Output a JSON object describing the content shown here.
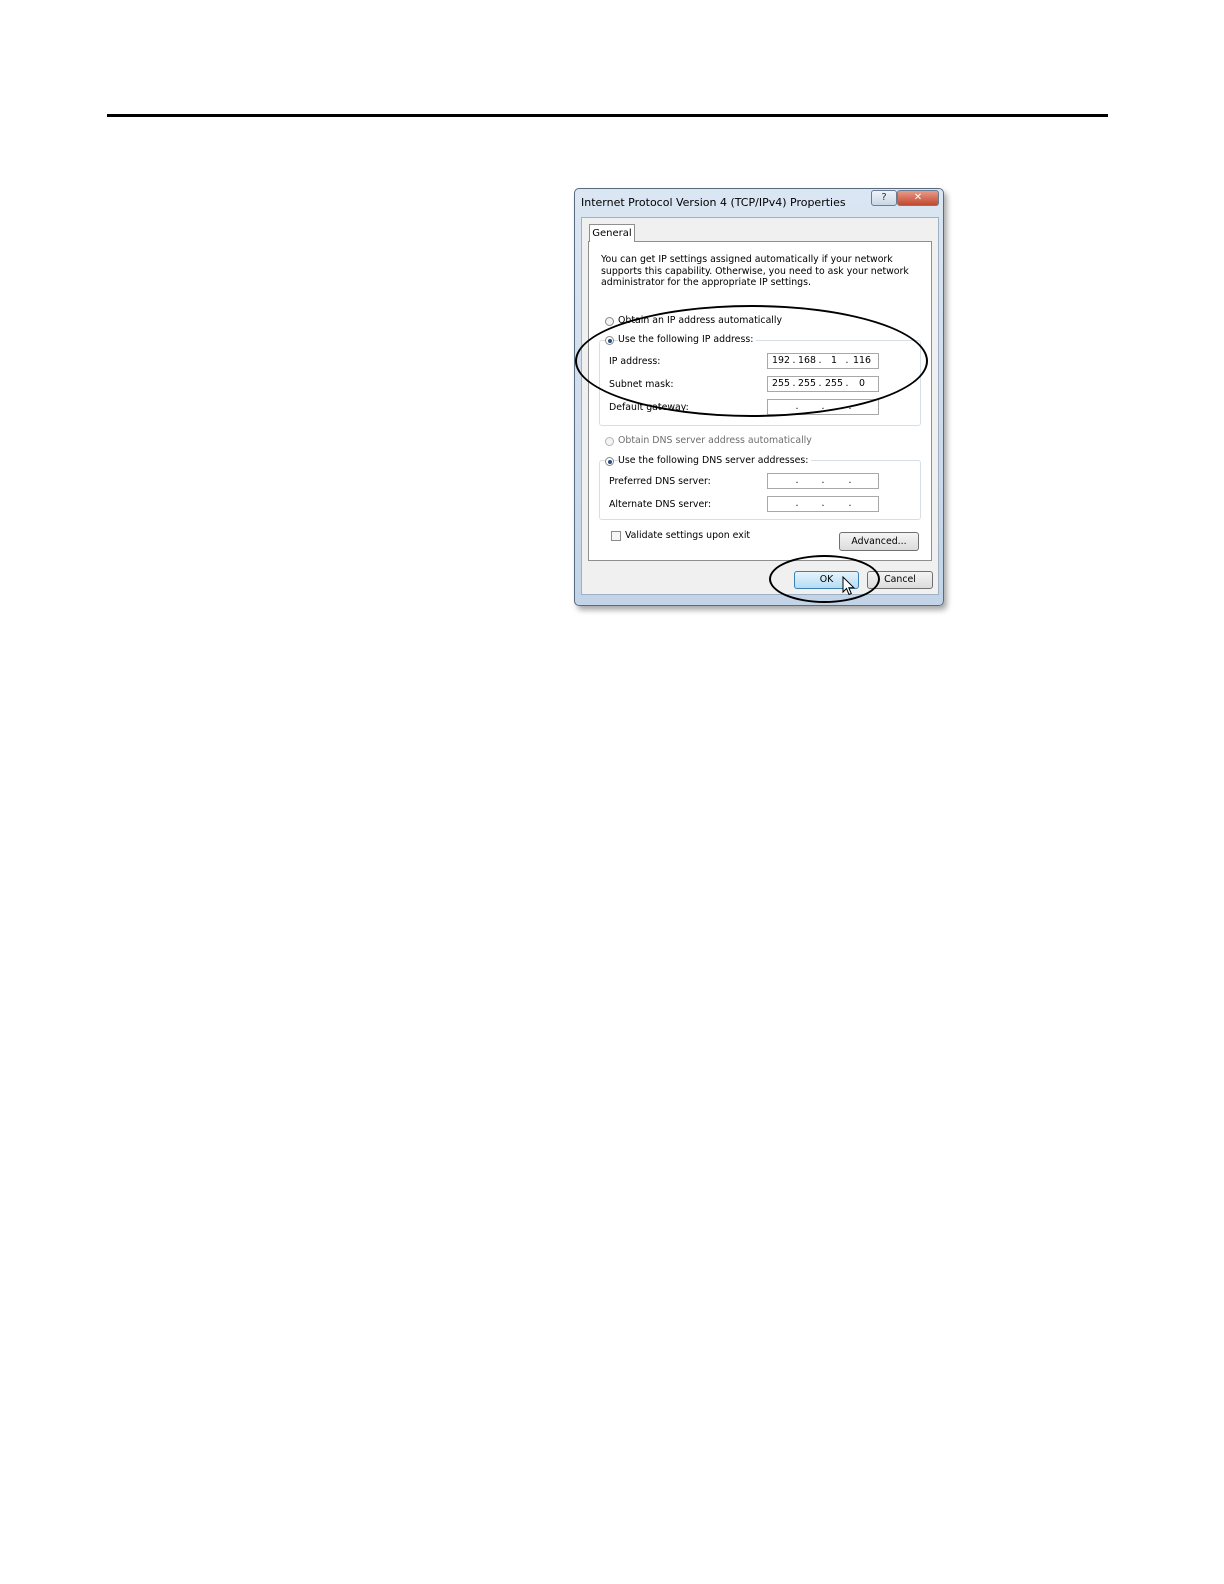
{
  "dialog": {
    "title": "Internet Protocol Version 4 (TCP/IPv4) Properties",
    "help_glyph": "?",
    "close_glyph": "✕",
    "tab_label": "General",
    "intro_text": "You can get IP settings assigned automatically if your network supports this capability. Otherwise, you need to ask your network administrator for the appropriate IP settings.",
    "ip_auto_label": "Obtain an IP address automatically",
    "ip_manual_label": "Use the following IP address:",
    "ip_address_label": "IP address:",
    "ip_address": [
      "192",
      "168",
      "1",
      "116"
    ],
    "subnet_label": "Subnet mask:",
    "subnet_mask": [
      "255",
      "255",
      "255",
      "0"
    ],
    "gateway_label": "Default gateway:",
    "gateway": [
      "",
      "",
      "",
      ""
    ],
    "dns_auto_label": "Obtain DNS server address automatically",
    "dns_manual_label": "Use the following DNS server addresses:",
    "preferred_dns_label": "Preferred DNS server:",
    "preferred_dns": [
      "",
      "",
      "",
      ""
    ],
    "alternate_dns_label": "Alternate DNS server:",
    "alternate_dns": [
      "",
      "",
      "",
      ""
    ],
    "validate_label": "Validate settings upon exit",
    "advanced_label": "Advanced...",
    "ok_label": "OK",
    "cancel_label": "Cancel"
  }
}
